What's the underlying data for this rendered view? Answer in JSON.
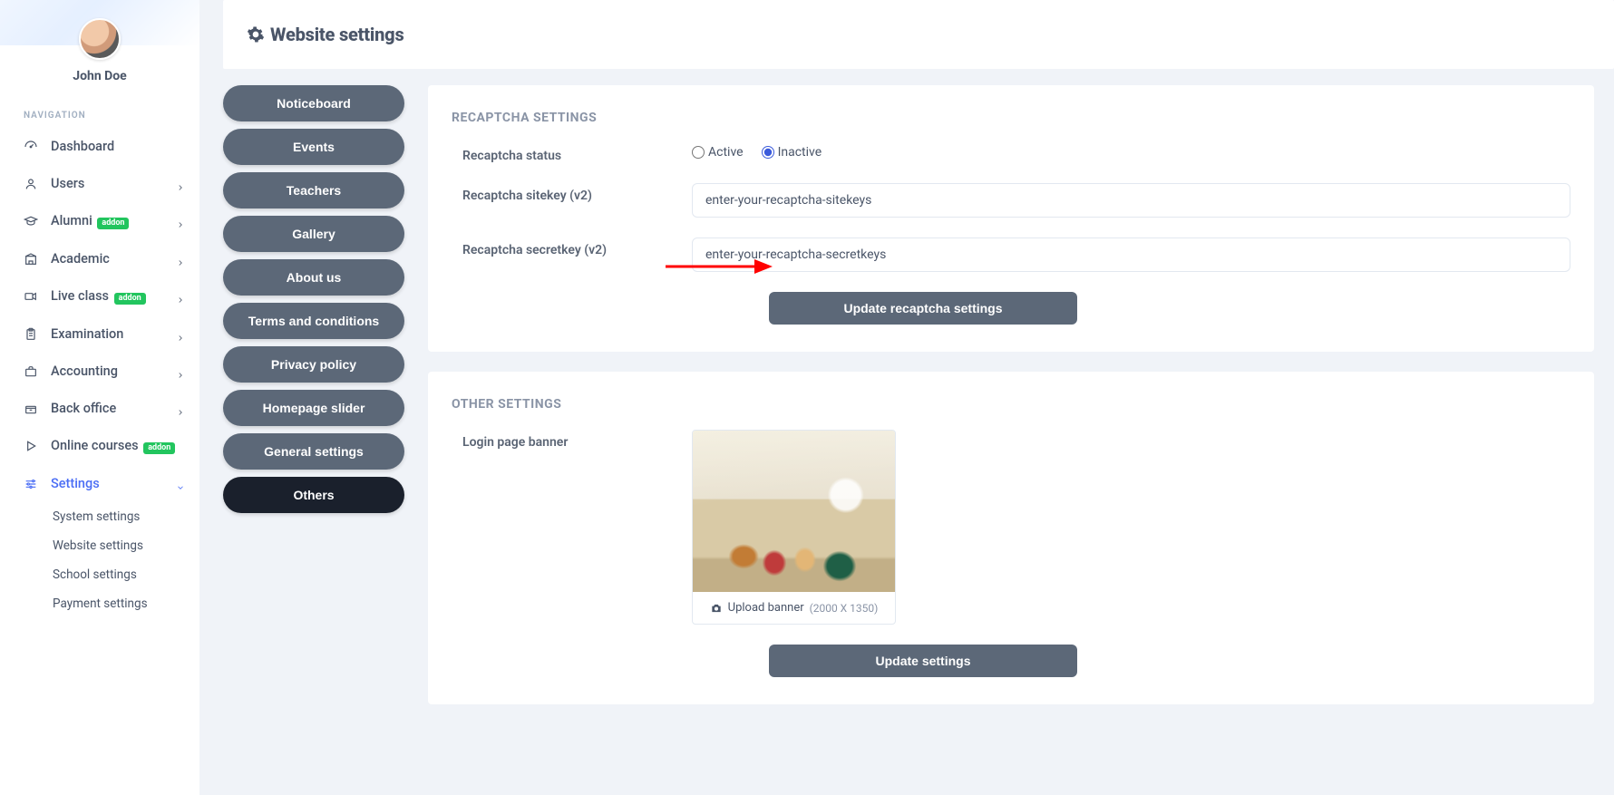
{
  "profile": {
    "name": "John Doe"
  },
  "nav_heading": "NAVIGATION",
  "nav": [
    {
      "label": "Dashboard",
      "expandable": false,
      "addon": false,
      "active": false
    },
    {
      "label": "Users",
      "expandable": true,
      "addon": false,
      "active": false
    },
    {
      "label": "Alumni",
      "expandable": true,
      "addon": true,
      "active": false
    },
    {
      "label": "Academic",
      "expandable": true,
      "addon": false,
      "active": false
    },
    {
      "label": "Live class",
      "expandable": true,
      "addon": true,
      "active": false
    },
    {
      "label": "Examination",
      "expandable": true,
      "addon": false,
      "active": false
    },
    {
      "label": "Accounting",
      "expandable": true,
      "addon": false,
      "active": false
    },
    {
      "label": "Back office",
      "expandable": true,
      "addon": false,
      "active": false
    },
    {
      "label": "Online courses",
      "expandable": false,
      "addon": true,
      "active": false
    },
    {
      "label": "Settings",
      "expandable": true,
      "addon": false,
      "active": true,
      "open": true
    }
  ],
  "sub_nav": [
    "System settings",
    "Website settings",
    "School settings",
    "Payment settings"
  ],
  "addon_badge": "addon",
  "page_title": "Website settings",
  "sub_tabs": [
    {
      "label": "Noticeboard",
      "active": false
    },
    {
      "label": "Events",
      "active": false
    },
    {
      "label": "Teachers",
      "active": false
    },
    {
      "label": "Gallery",
      "active": false
    },
    {
      "label": "About us",
      "active": false
    },
    {
      "label": "Terms and conditions",
      "active": false
    },
    {
      "label": "Privacy policy",
      "active": false
    },
    {
      "label": "Homepage slider",
      "active": false
    },
    {
      "label": "General settings",
      "active": false
    },
    {
      "label": "Others",
      "active": true
    }
  ],
  "recaptcha": {
    "section_title": "RECAPTCHA SETTINGS",
    "status_label": "Recaptcha status",
    "active_label": "Active",
    "inactive_label": "Inactive",
    "status_value": "inactive",
    "sitekey_label": "Recaptcha sitekey (v2)",
    "sitekey_value": "enter-your-recaptcha-sitekeys",
    "secretkey_label": "Recaptcha secretkey (v2)",
    "secretkey_value": "enter-your-recaptcha-secretkeys",
    "submit_label": "Update recaptcha settings"
  },
  "other": {
    "section_title": "OTHER SETTINGS",
    "banner_label": "Login page banner",
    "upload_label": "Upload banner",
    "upload_dim": "(2000 X 1350)",
    "submit_label": "Update settings"
  }
}
